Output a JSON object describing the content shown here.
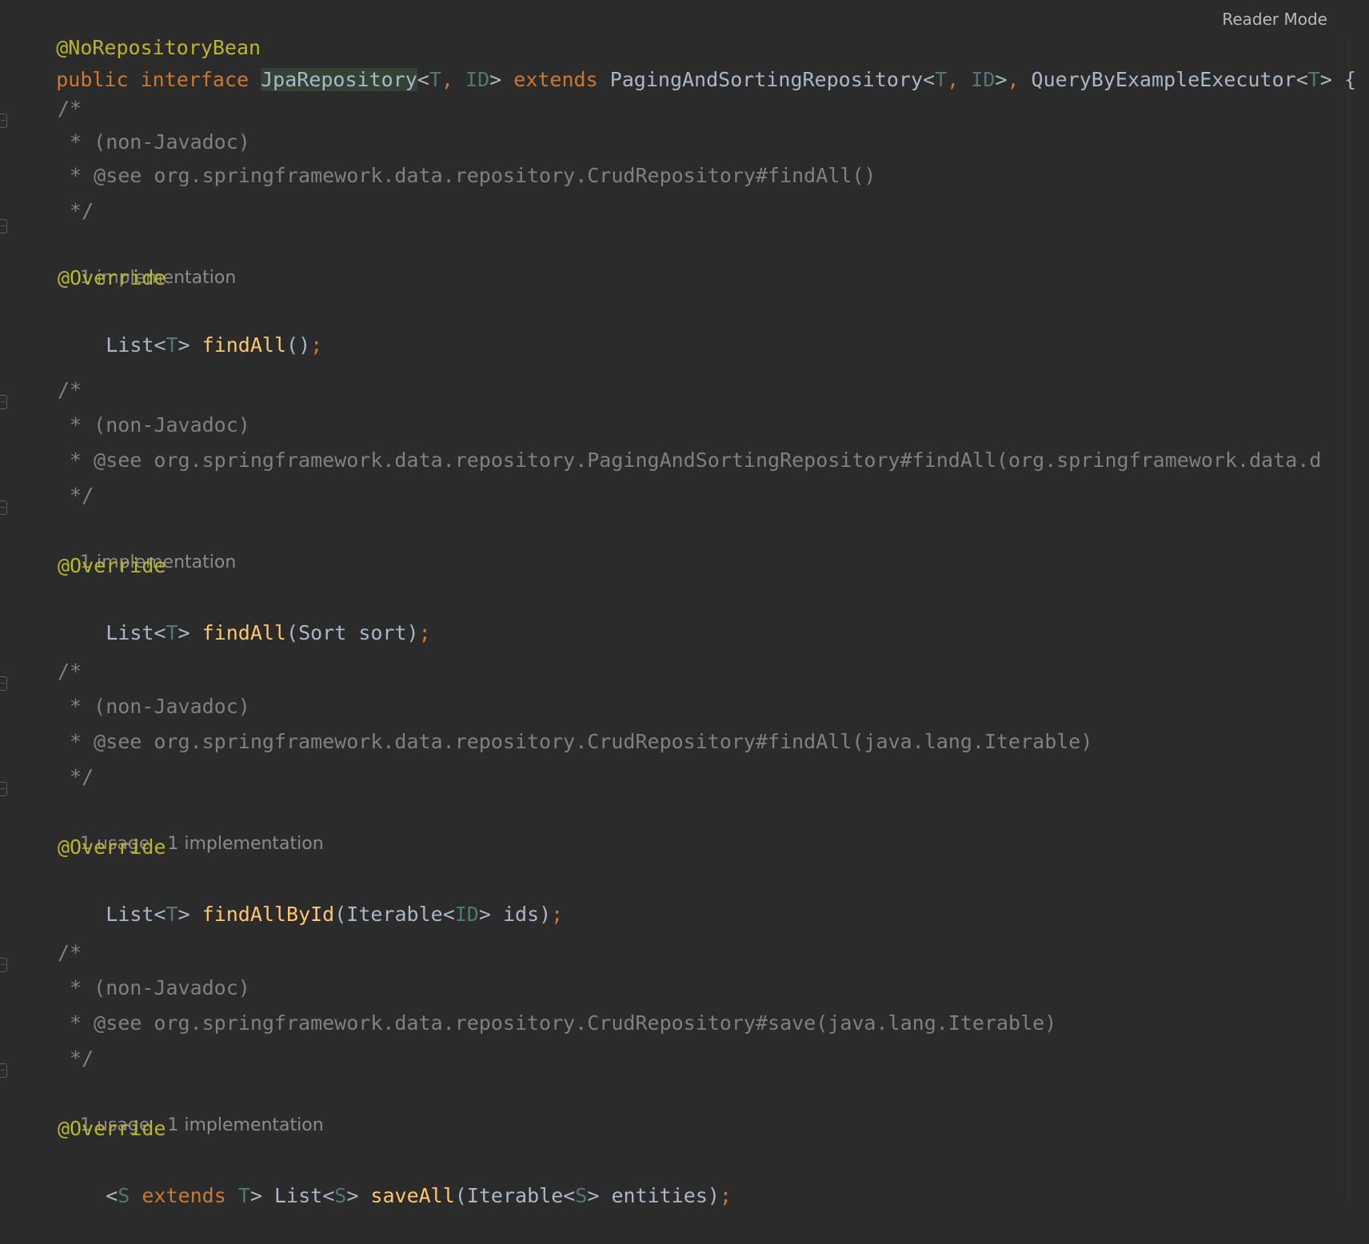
{
  "header": {
    "reader_mode_label": "Reader Mode"
  },
  "code": {
    "annotation_top": "@NoRepositoryBean",
    "decl": {
      "public": "public",
      "interface": "interface",
      "name": "JpaRepository",
      "lt1": "<",
      "T1": "T",
      "comma1": ", ",
      "ID1": "ID",
      "gt1": ">",
      "extends": "extends",
      "paging": "PagingAndSortingRepository",
      "lt2": "<",
      "T2": "T",
      "comma2": ", ",
      "ID2": "ID",
      "gt2": ">",
      "comma3": ", ",
      "qbe": "QueryByExampleExecutor",
      "lt3": "<",
      "T3": "T",
      "gt3": ">",
      "brace": "{"
    },
    "blocks": [
      {
        "comment_open": "/*",
        "comment_line1": " * (non-Javadoc)",
        "comment_line2": " * @see org.springframework.data.repository.CrudRepository#findAll()",
        "comment_close": " */",
        "hint_usage": "",
        "hint_impl": "1 implementation",
        "override": "@Override",
        "sig": {
          "pre": "",
          "list": "List<",
          "T": "T",
          "gt": "> ",
          "method": "findAll",
          "params_before": "()",
          "param_type": "",
          "param_after": "",
          "semi": ";"
        }
      },
      {
        "comment_open": "/*",
        "comment_line1": " * (non-Javadoc)",
        "comment_line2": " * @see org.springframework.data.repository.PagingAndSortingRepository#findAll(org.springframework.data.d",
        "comment_close": " */",
        "hint_usage": "",
        "hint_impl": "1 implementation",
        "override": "@Override",
        "sig": {
          "list": "List<",
          "T": "T",
          "gt": "> ",
          "method": "findAll",
          "params_before": "(Sort sort)",
          "semi": ";"
        }
      },
      {
        "comment_open": "/*",
        "comment_line1": " * (non-Javadoc)",
        "comment_line2": " * @see org.springframework.data.repository.CrudRepository#findAll(java.lang.Iterable)",
        "comment_close": " */",
        "hint_usage": "1 usage",
        "hint_impl": "1 implementation",
        "override": "@Override",
        "sig": {
          "list": "List<",
          "T": "T",
          "gt": "> ",
          "method": "findAllById",
          "p1": "(Iterable<",
          "ID": "ID",
          "p2": "> ids)",
          "semi": ";"
        }
      },
      {
        "comment_open": "/*",
        "comment_line1": " * (non-Javadoc)",
        "comment_line2": " * @see org.springframework.data.repository.CrudRepository#save(java.lang.Iterable)",
        "comment_close": " */",
        "hint_usage": "1 usage",
        "hint_impl": "1 implementation",
        "override": "@Override",
        "sig": {
          "lt": "<",
          "S1": "S",
          "extends": " extends ",
          "T": "T",
          "gt1": "> ",
          "list": "List<",
          "S2": "S",
          "gt2": "> ",
          "method": "saveAll",
          "p1": "(Iterable<",
          "S3": "S",
          "p2": "> entities)",
          "semi": ";"
        }
      }
    ]
  }
}
